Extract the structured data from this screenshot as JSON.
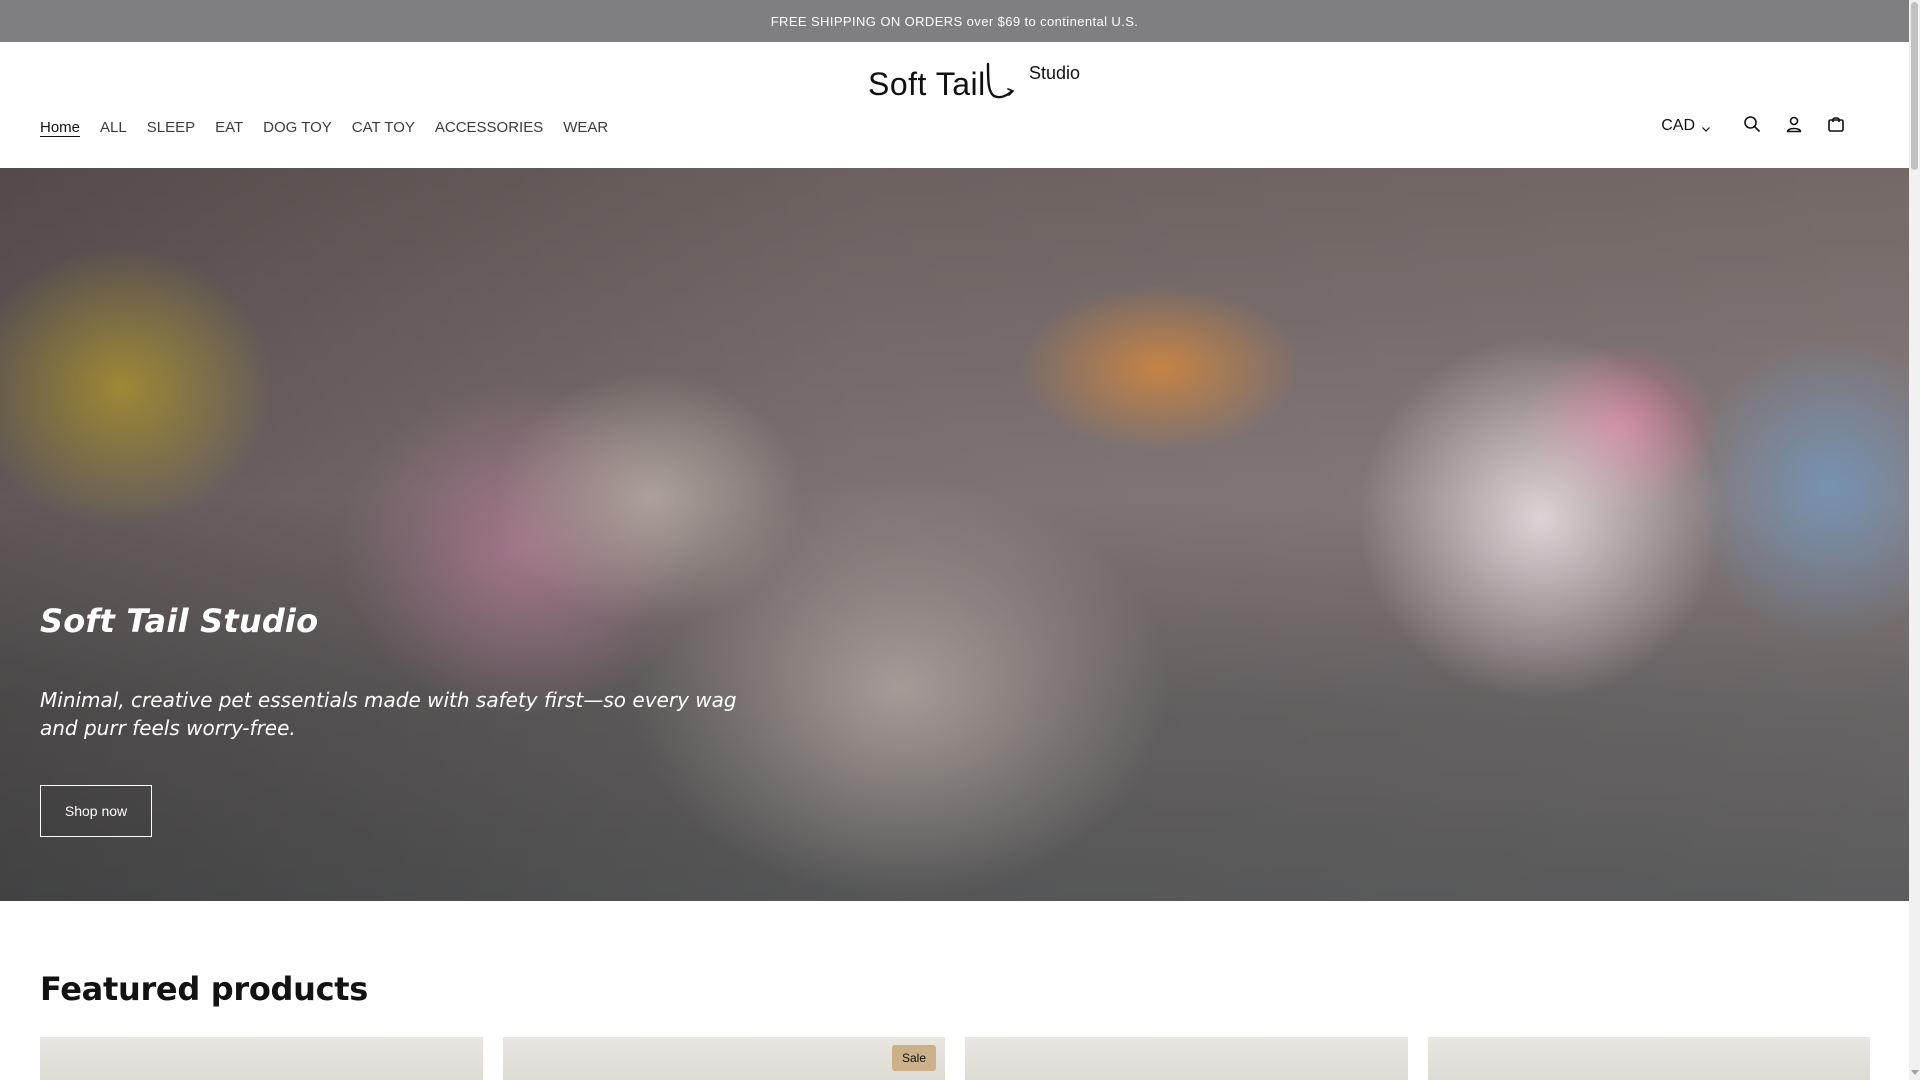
{
  "announcement": {
    "text": "FREE SHIPPING ON ORDERS over $69 to continental U.S."
  },
  "header": {
    "logo": {
      "main": "Soft Tail",
      "sub": "Studio"
    },
    "nav": [
      {
        "label": "Home",
        "active": true
      },
      {
        "label": "ALL"
      },
      {
        "label": "SLEEP"
      },
      {
        "label": "EAT"
      },
      {
        "label": "DOG TOY"
      },
      {
        "label": "CAT TOY"
      },
      {
        "label": "ACCESSORIES"
      },
      {
        "label": "WEAR"
      }
    ],
    "utilities": {
      "currency": "CAD",
      "icons": [
        "search-icon",
        "account-icon",
        "cart-icon"
      ]
    }
  },
  "hero": {
    "title": "Soft Tail Studio",
    "subtitle": "Minimal, creative pet essentials made with safety first—so every wag and purr feels worry-free.",
    "cta_label": "Shop now"
  },
  "featured": {
    "title": "Featured products",
    "products": [
      {
        "badge": ""
      },
      {
        "badge": "Sale"
      },
      {
        "badge": ""
      },
      {
        "badge": ""
      }
    ]
  },
  "colors": {
    "announcement_bg": "#7f7e80",
    "text": "#121212",
    "sale_badge": "#cbb08a"
  }
}
